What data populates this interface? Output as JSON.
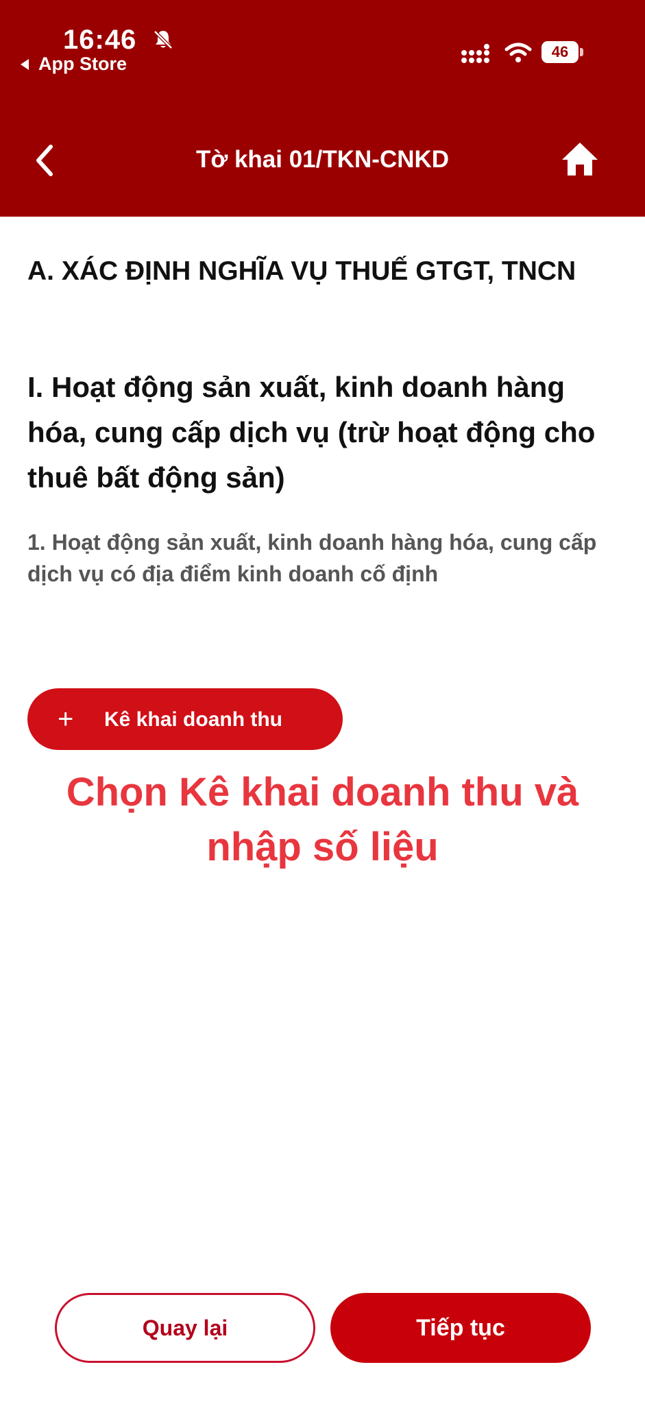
{
  "status_bar": {
    "time": "16:46",
    "back_app": "App Store",
    "battery": "46",
    "icons": [
      "bell-off-icon",
      "signal-icon",
      "wifi-icon",
      "battery-icon"
    ]
  },
  "nav": {
    "title": "Tờ khai 01/TKN-CNKD",
    "back_icon": "chevron-left-icon",
    "home_icon": "home-icon"
  },
  "content": {
    "section_a": "A. XÁC ĐỊNH NGHĨA VỤ THUẾ GTGT, TNCN",
    "section_i": "I. Hoạt động sản xuất, kinh doanh hàng hóa, cung cấp dịch vụ (trừ hoạt động cho thuê bất động sản)",
    "subsection_1": "1. Hoạt động sản xuất, kinh doanh hàng hóa, cung cấp dịch vụ có địa điểm kinh doanh cố định",
    "declare_button": {
      "icon": "+",
      "label": "Kê khai doanh thu"
    }
  },
  "annotation": {
    "line1": "Chọn Kê khai doanh thu và",
    "line2": "nhập số liệu"
  },
  "footer": {
    "back_label": "Quay lại",
    "next_label": "Tiếp tục"
  },
  "colors": {
    "header_bg": "#9b0000",
    "primary_red": "#d00f16",
    "annotation_red": "#e8363f"
  }
}
